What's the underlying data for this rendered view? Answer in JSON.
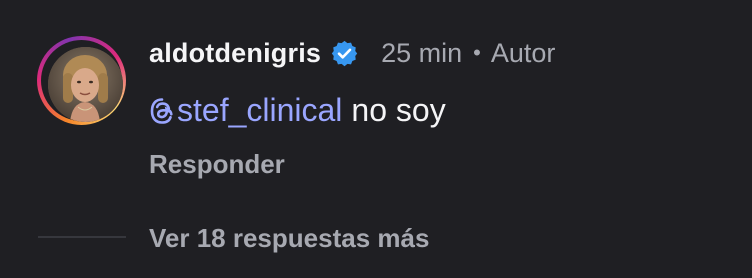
{
  "comment": {
    "username": "aldotdenigris",
    "verified": true,
    "time": "25 min",
    "separator": "•",
    "role": "Autor",
    "mention": "stef_clinical",
    "text": "no soy",
    "reply_label": "Responder",
    "more_replies_label": "Ver 18 respuestas más"
  },
  "colors": {
    "background": "#1f1f23",
    "mention": "#9aa6ff",
    "secondary_text": "#a7a9b1",
    "verified_badge": "#3797f0"
  },
  "icons": {
    "verified": "verified-badge-icon",
    "mention": "threads-icon",
    "avatar": "profile-photo"
  }
}
